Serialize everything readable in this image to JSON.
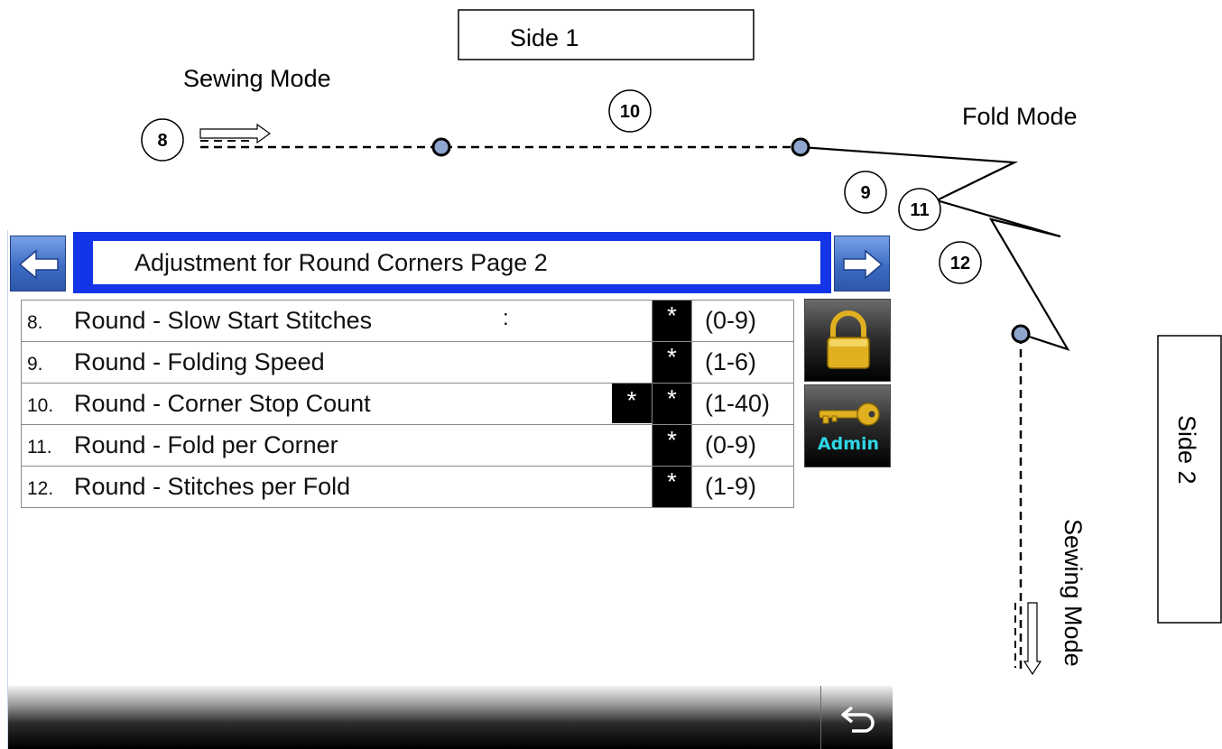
{
  "diagram": {
    "side_1_label": "Side 1",
    "side_2_label": "Side 2",
    "sewing_mode_top": "Sewing Mode",
    "sewing_mode_side": "Sewing Mode",
    "fold_mode": "Fold Mode",
    "markers": [
      "8",
      "10",
      "9",
      "11",
      "12"
    ]
  },
  "panel": {
    "title": "Adjustment for Round Corners Page 2",
    "params": [
      {
        "num": "8.",
        "label": "Round - Slow Start Stitches",
        "suffix": ":",
        "value": "*",
        "range": "(0-9)"
      },
      {
        "num": "9.",
        "label": "Round - Folding Speed",
        "suffix": "",
        "value": "*",
        "range": "(1-6)"
      },
      {
        "num": "10.",
        "label": "Round - Corner Stop Count",
        "suffix": "",
        "value": "*",
        "extra_value": "*",
        "range": "(1-40)"
      },
      {
        "num": "11.",
        "label": "Round - Fold per Corner",
        "suffix": "",
        "value": "*",
        "range": "(0-9)"
      },
      {
        "num": "12.",
        "label": "Round - Stitches per Fold",
        "suffix": "",
        "value": "*",
        "range": "(1-9)"
      }
    ],
    "admin_label": "Admin",
    "icons": {
      "prev": "arrow-left-icon",
      "next": "arrow-right-icon",
      "lock": "padlock-icon",
      "key": "key-icon",
      "back": "return-arrow-icon"
    },
    "colors": {
      "title_border": "#1434e8",
      "nav_blue": "#3d6cc4",
      "admin_text": "#2fd6e6",
      "lock_gold": "#e0b020"
    }
  }
}
